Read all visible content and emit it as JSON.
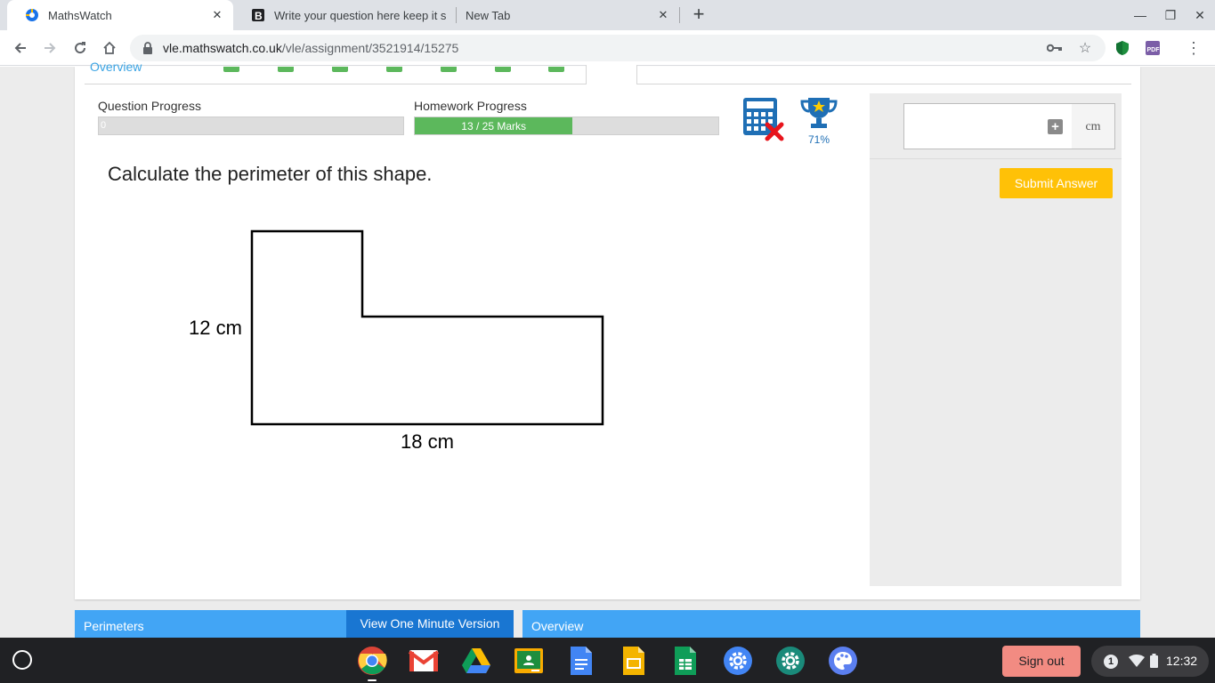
{
  "browser": {
    "tabs": [
      {
        "title": "MathsWatch",
        "active": true
      },
      {
        "title": "Write your question here keep it s",
        "active": false
      },
      {
        "title": "New Tab",
        "active": false
      }
    ],
    "url_host": "vle.mathswatch.co.uk",
    "url_path": "/vle/assignment/3521914/15275"
  },
  "page": {
    "question_nav": {
      "overview_label": "Overview",
      "completed_count": 7
    },
    "question_progress": {
      "label": "Question Progress",
      "value_text": "0",
      "fraction": 0
    },
    "homework_progress": {
      "label": "Homework Progress",
      "value_text": "13 / 25 Marks",
      "fraction": 0.52
    },
    "trophy_percent": "71%",
    "question_text": "Calculate the perimeter of this shape.",
    "shape": {
      "height_label": "12 cm",
      "width_label": "18 cm"
    },
    "answer": {
      "unit": "cm",
      "value": "",
      "submit_label": "Submit Answer"
    },
    "bottom": {
      "topic_label": "Perimeters",
      "one_minute_label": "View One Minute Version",
      "overview_label": "Overview"
    }
  },
  "shelf": {
    "sign_out_label": "Sign out",
    "notification_count": "1",
    "time": "12:32"
  },
  "colors": {
    "accent_blue": "#42a5f5",
    "progress_green": "#5cb85c",
    "submit_yellow": "#ffc107",
    "sign_out_red": "#f28b82"
  }
}
